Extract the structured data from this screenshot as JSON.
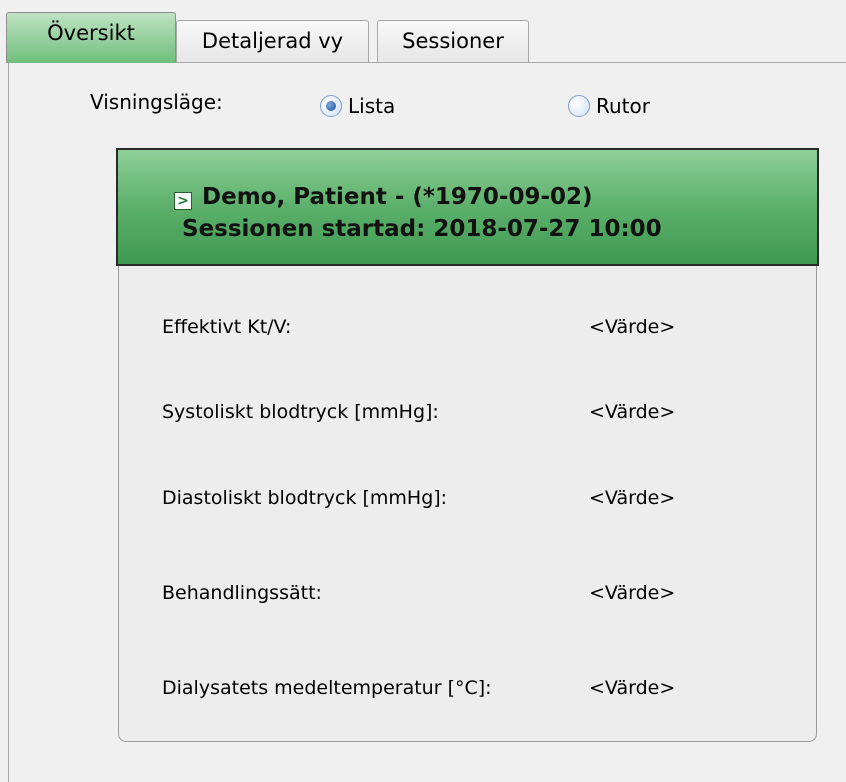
{
  "tabs": [
    {
      "label": "Översikt",
      "active": true
    },
    {
      "label": "Detaljerad vy",
      "active": false
    },
    {
      "label": "Sessioner",
      "active": false
    }
  ],
  "view_mode": {
    "label": "Visningsläge:",
    "options": [
      {
        "label": "Lista",
        "selected": true
      },
      {
        "label": "Rutor",
        "selected": false
      }
    ]
  },
  "patient": {
    "expand_icon": "expand-arrow-icon",
    "name_line": "Demo, Patient - (*1970-09-02)",
    "session_line": "Sessionen startad: 2018-07-27 10:00"
  },
  "details": [
    {
      "label": "Effektivt Kt/V:",
      "value": "<Värde>"
    },
    {
      "label": "Systoliskt blodtryck [mmHg]:",
      "value": "<Värde>"
    },
    {
      "label": "Diastoliskt blodtryck [mmHg]:",
      "value": "<Värde>"
    },
    {
      "label": "Behandlingssätt:",
      "value": "<Värde>"
    },
    {
      "label": "Dialysatets medeltemperatur [°C]:",
      "value": "<Värde>"
    }
  ],
  "colors": {
    "active_tab": "#6fbe7c",
    "patient_header": "#5cb06b",
    "radio_selected": "#1d4f9e"
  }
}
